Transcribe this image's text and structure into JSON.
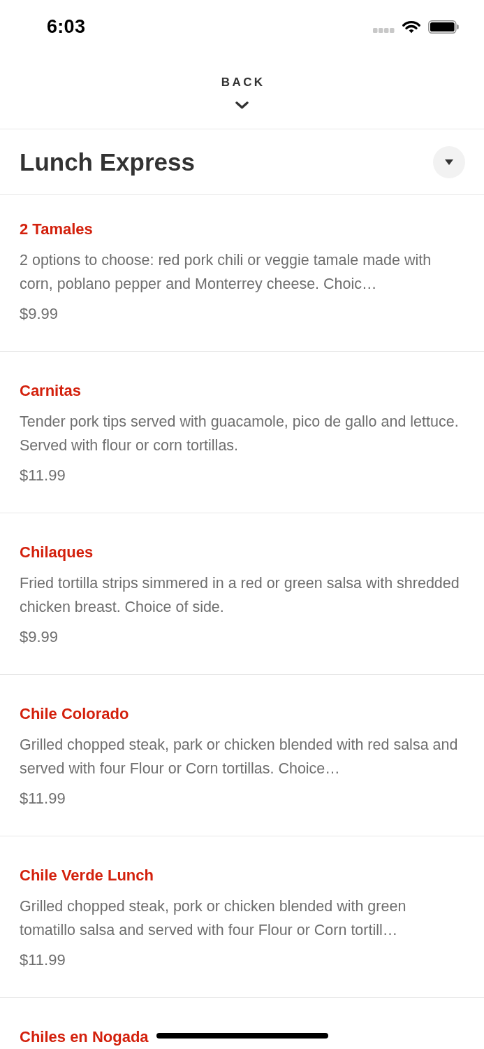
{
  "status_bar": {
    "time": "6:03"
  },
  "nav": {
    "back_label": "BACK"
  },
  "section": {
    "title": "Lunch Express"
  },
  "items": [
    {
      "name": "2 Tamales",
      "description": "2 options to choose: red pork chili or veggie tamale made with corn, poblano pepper and Monterrey cheese. Choic…",
      "price": "$9.99"
    },
    {
      "name": "Carnitas",
      "description": "Tender pork tips served with guacamole, pico de gallo and lettuce. Served with flour or corn tortillas.",
      "price": "$11.99"
    },
    {
      "name": "Chilaques",
      "description": "Fried tortilla strips simmered in a red or green salsa with shredded chicken breast. Choice of side.",
      "price": "$9.99"
    },
    {
      "name": "Chile Colorado",
      "description": "Grilled chopped steak, park or chicken blended with red salsa and served with four Flour or Corn tortillas. Choice…",
      "price": "$11.99"
    },
    {
      "name": "Chile Verde Lunch",
      "description": "Grilled chopped steak, pork or chicken blended with green tomatillo salsa and served with four Flour or Corn tortill…",
      "price": "$11.99"
    },
    {
      "name": "Chiles en Nogada"
    }
  ]
}
